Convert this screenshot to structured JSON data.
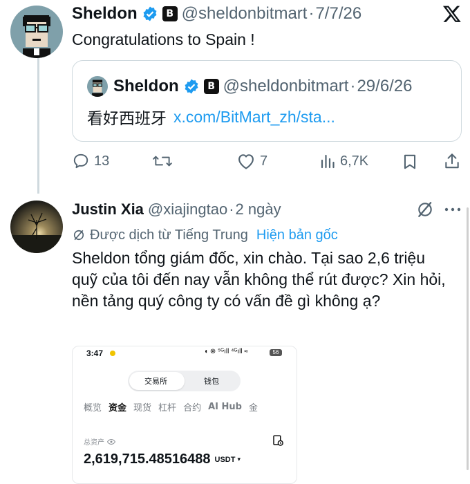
{
  "tweet": {
    "name": "Sheldon",
    "affiliate_badge": "B",
    "handle": "@sheldonbitmart",
    "sep": "·",
    "date": "7/7/26",
    "text": "Congratulations to Spain !",
    "quote": {
      "name": "Sheldon",
      "affiliate_badge": "B",
      "handle": "@sheldonbitmart",
      "sep": "·",
      "date": "29/6/26",
      "text": "看好西班牙",
      "link": "x.com/BitMart_zh/sta..."
    },
    "actions": {
      "replies": "13",
      "retweets": "",
      "likes": "7",
      "views": "6,7K"
    }
  },
  "reply": {
    "name": "Justin Xia",
    "handle": "@xiajingtao",
    "sep": "·",
    "date": "2 ngày",
    "translated_label": "Được dịch từ Tiếng Trung",
    "show_original": "Hiện bản gốc",
    "text": "Sheldon tổng giám đốc, xin chào. Tại sao 2,6 triệu quỹ của tôi đến nay vẫn không thể rút được? Xin hỏi, nền tảng quý công ty có vấn đề gì không ạ?",
    "screenshot": {
      "time": "3:47",
      "status_icons": "◖ ⊗ ⁵ᴳıll ⁴ᴳıll ≈",
      "battery": "56",
      "segments": [
        "交易所",
        "钱包"
      ],
      "tabs": [
        "概览",
        "资金",
        "现货",
        "杠杆",
        "合约",
        "AI Hub",
        "金"
      ],
      "total_assets_label": "总资产",
      "total_assets_value": "2,619,715.48516488",
      "currency": "USDT"
    }
  },
  "icons": {
    "x_logo": "x-logo-icon",
    "verified": "verified-badge-icon",
    "reply": "reply-icon",
    "retweet": "retweet-icon",
    "like": "heart-icon",
    "views": "views-icon",
    "bookmark": "bookmark-icon",
    "share": "share-icon",
    "grok": "grok-icon",
    "more": "more-icon"
  },
  "colors": {
    "link": "#1d9bf0",
    "verified": "#1d9bf0",
    "muted": "#536471",
    "border": "#cfd9de"
  }
}
